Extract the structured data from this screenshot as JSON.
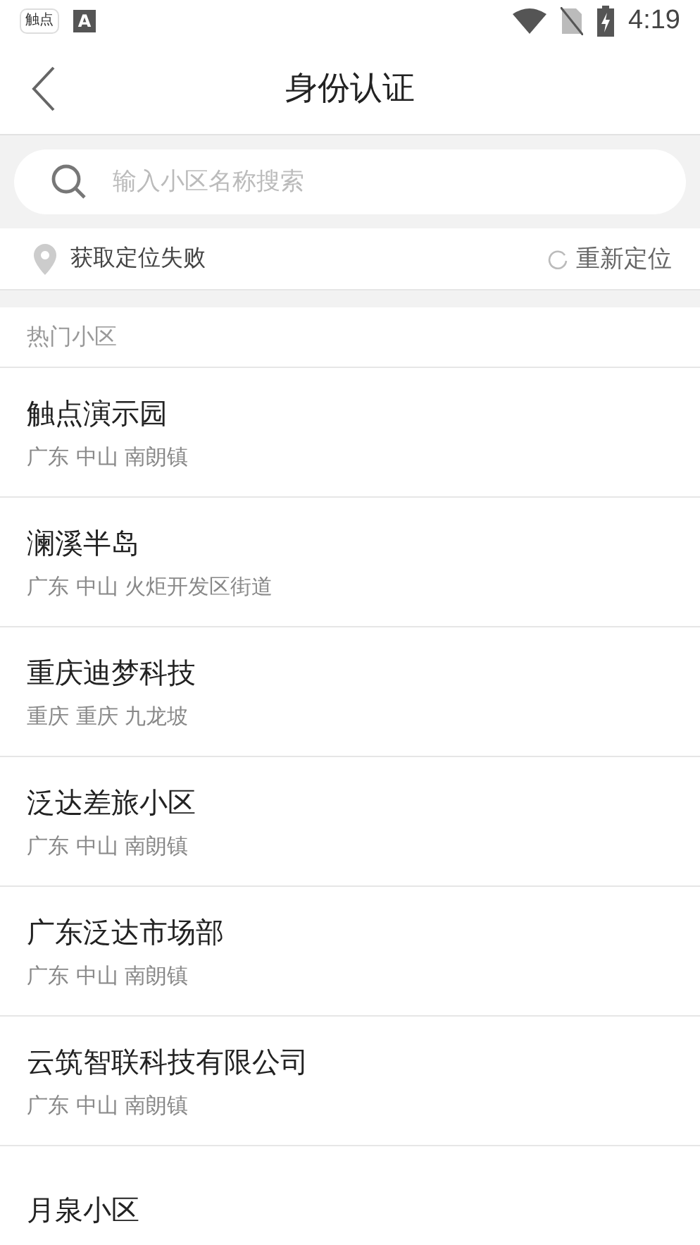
{
  "status_bar": {
    "app_icon_label": "触点",
    "second_icon_label": "A",
    "time": "4:19"
  },
  "header": {
    "title": "身份认证"
  },
  "search": {
    "placeholder": "输入小区名称搜索"
  },
  "location": {
    "status": "获取定位失败",
    "relocate": "重新定位"
  },
  "section_title": "热门小区",
  "communities": [
    {
      "name": "触点演示园",
      "address": "广东 中山 南朗镇"
    },
    {
      "name": "澜溪半岛",
      "address": "广东 中山 火炬开发区街道"
    },
    {
      "name": "重庆迪梦科技",
      "address": "重庆 重庆 九龙坡"
    },
    {
      "name": "泛达差旅小区",
      "address": "广东 中山 南朗镇"
    },
    {
      "name": "广东泛达市场部",
      "address": "广东 中山 南朗镇"
    },
    {
      "name": "云筑智联科技有限公司",
      "address": "广东 中山 南朗镇"
    },
    {
      "name": "月泉小区"
    }
  ]
}
